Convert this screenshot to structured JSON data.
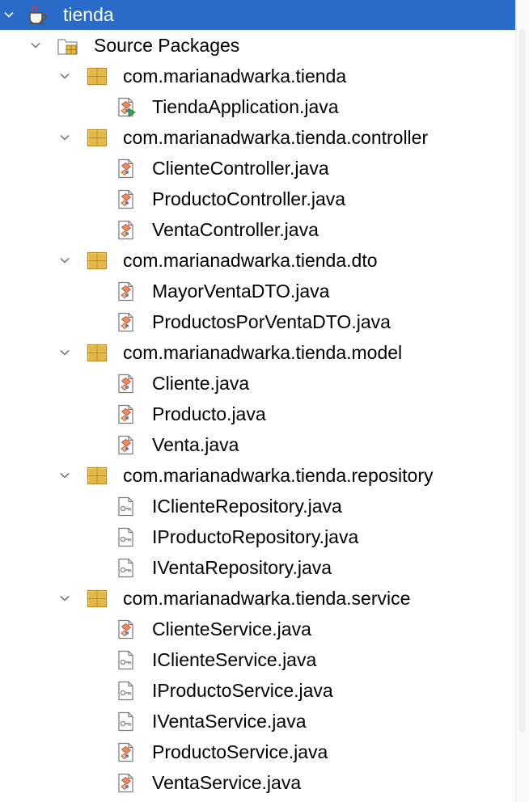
{
  "project": {
    "name": "tienda",
    "icon": "coffee-cup-project-icon"
  },
  "source_root": {
    "label": "Source Packages",
    "icon": "source-folder-icon"
  },
  "packages": [
    {
      "name": "com.marianadwarka.tienda",
      "files": [
        {
          "name": "TiendaApplication.java",
          "kind": "main-class"
        }
      ]
    },
    {
      "name": "com.marianadwarka.tienda.controller",
      "files": [
        {
          "name": "ClienteController.java",
          "kind": "class"
        },
        {
          "name": "ProductoController.java",
          "kind": "class"
        },
        {
          "name": "VentaController.java",
          "kind": "class"
        }
      ]
    },
    {
      "name": "com.marianadwarka.tienda.dto",
      "files": [
        {
          "name": "MayorVentaDTO.java",
          "kind": "class"
        },
        {
          "name": "ProductosPorVentaDTO.java",
          "kind": "class"
        }
      ]
    },
    {
      "name": "com.marianadwarka.tienda.model",
      "files": [
        {
          "name": "Cliente.java",
          "kind": "class"
        },
        {
          "name": "Producto.java",
          "kind": "class"
        },
        {
          "name": "Venta.java",
          "kind": "class"
        }
      ]
    },
    {
      "name": "com.marianadwarka.tienda.repository",
      "files": [
        {
          "name": "IClienteRepository.java",
          "kind": "interface"
        },
        {
          "name": "IProductoRepository.java",
          "kind": "interface"
        },
        {
          "name": "IVentaRepository.java",
          "kind": "interface"
        }
      ]
    },
    {
      "name": "com.marianadwarka.tienda.service",
      "files": [
        {
          "name": "ClienteService.java",
          "kind": "class"
        },
        {
          "name": "IClienteService.java",
          "kind": "interface"
        },
        {
          "name": "IProductoService.java",
          "kind": "interface"
        },
        {
          "name": "IVentaService.java",
          "kind": "interface"
        },
        {
          "name": "ProductoService.java",
          "kind": "class"
        },
        {
          "name": "VentaService.java",
          "kind": "class"
        }
      ]
    }
  ],
  "colors": {
    "selection": "#2a6ac9",
    "package": "#e2b84a",
    "class": "#f28a60",
    "interface": "#8c8c8c"
  }
}
